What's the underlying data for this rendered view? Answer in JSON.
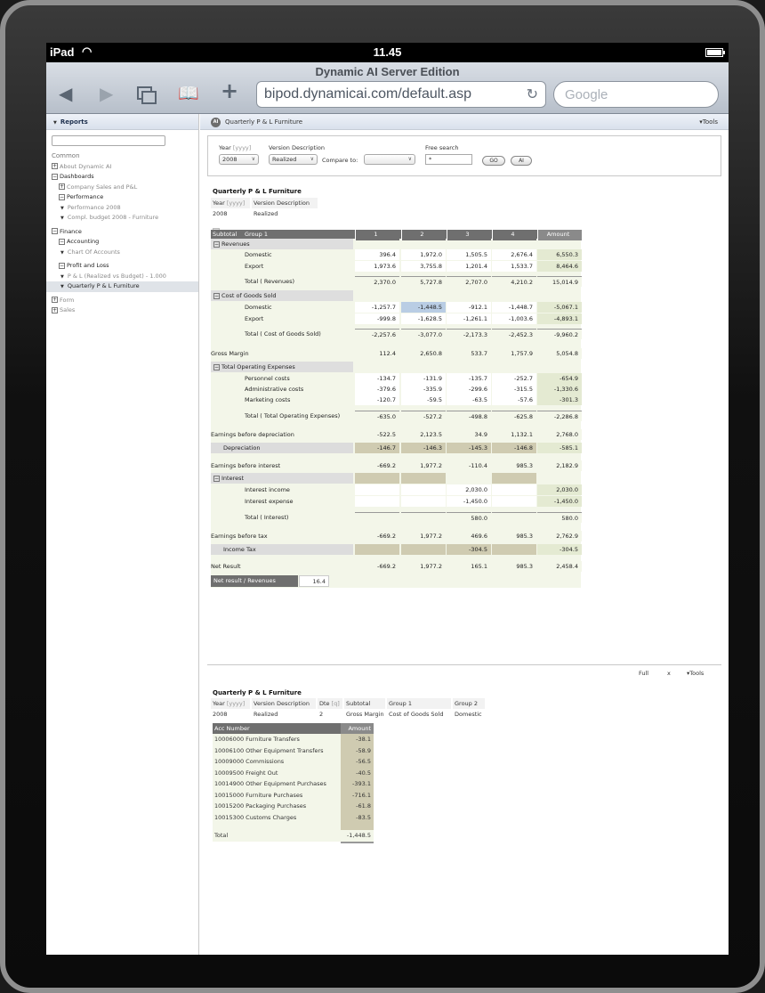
{
  "device": {
    "carrier": "iPad",
    "time": "11.45",
    "browser_title": "Dynamic AI Server Edition",
    "url": "bipod.dynamicai.com/default.asp",
    "search_placeholder": "Google"
  },
  "sidebar": {
    "title": "Reports",
    "section_common": "Common",
    "about": "About Dynamic AI",
    "dashboards": "Dashboards",
    "company_sales": "Company Sales and P&L",
    "performance": "Performance",
    "performance_2008": "Performance 2008",
    "compl_budget": "Compl. budget 2008 - Furniture",
    "finance": "Finance",
    "accounting": "Accounting",
    "chart_of_accounts": "Chart Of Accounts",
    "profit_and_loss": "Profit and Loss",
    "pl_realized_vs_budget": "P & L (Realized vs Budget) - 1.000",
    "quarterly_pl_furniture": "Quarterly P & L Furniture",
    "form": "Form",
    "sales": "Sales"
  },
  "main": {
    "header_title": "Quarterly P & L Furniture",
    "tools": "Tools",
    "filters": {
      "year_label": "Year",
      "year_hint": "[yyyy]",
      "year_value": "2008",
      "version_label": "Version Description",
      "version_value": "Realized",
      "compare_label": "Compare to:",
      "compare_value": "",
      "free_search_label": "Free search",
      "free_search_value": "*",
      "go_button": "GO",
      "ai_button": "AI"
    },
    "report": {
      "title": "Quarterly P & L Furniture",
      "meta_year_label": "Year",
      "meta_year_hint": "[yyyy]",
      "meta_version_label": "Version Description",
      "meta_year_value": "2008",
      "meta_version_value": "Realized",
      "minus_glyph": "−",
      "columns": [
        "Subtotal",
        "Group 1",
        "1",
        "2",
        "3",
        "4",
        "Amount"
      ],
      "revenues": "Revenues",
      "domestic": "Domestic",
      "export": "Export",
      "total_revenues": "Total ( Revenues)",
      "cogs": "Cost of Goods Sold",
      "total_cogs": "Total ( Cost of Goods Sold)",
      "gross_margin": "Gross Margin",
      "total_opex": "Total Operating Expenses",
      "personnel": "Personnel costs",
      "admin": "Administrative costs",
      "marketing": "Marketing costs",
      "total_total_opex": "Total ( Total Operating Expenses)",
      "ebd": "Earnings before depreciation",
      "depreciation": "Depreciation",
      "ebi": "Earnings before interest",
      "interest": "Interest",
      "interest_income": "Interest income",
      "interest_expense": "Interest expense",
      "total_interest": "Total ( Interest)",
      "ebt": "Earnings before tax",
      "income_tax": "Income Tax",
      "net_result": "Net Result",
      "net_result_revenues": "Net result / Revenues",
      "net_result_revenues_value": "16.4",
      "values": {
        "rev_dom": [
          "396.4",
          "1,972.0",
          "1,505.5",
          "2,676.4",
          "6,550.3"
        ],
        "rev_exp": [
          "1,973.6",
          "3,755.8",
          "1,201.4",
          "1,533.7",
          "8,464.6"
        ],
        "rev_tot": [
          "2,370.0",
          "5,727.8",
          "2,707.0",
          "4,210.2",
          "15,014.9"
        ],
        "cogs_dom": [
          "-1,257.7",
          "-1,448.5",
          "-912.1",
          "-1,448.7",
          "-5,067.1"
        ],
        "cogs_exp": [
          "-999.8",
          "-1,628.5",
          "-1,261.1",
          "-1,003.6",
          "-4,893.1"
        ],
        "cogs_tot": [
          "-2,257.6",
          "-3,077.0",
          "-2,173.3",
          "-2,452.3",
          "-9,960.2"
        ],
        "gross": [
          "112.4",
          "2,650.8",
          "533.7",
          "1,757.9",
          "5,054.8"
        ],
        "pers": [
          "-134.7",
          "-131.9",
          "-135.7",
          "-252.7",
          "-654.9"
        ],
        "admin": [
          "-379.6",
          "-335.9",
          "-299.6",
          "-315.5",
          "-1,330.6"
        ],
        "mkt": [
          "-120.7",
          "-59.5",
          "-63.5",
          "-57.6",
          "-301.3"
        ],
        "opex_tot": [
          "-635.0",
          "-527.2",
          "-498.8",
          "-625.8",
          "-2,286.8"
        ],
        "ebd": [
          "-522.5",
          "2,123.5",
          "34.9",
          "1,132.1",
          "2,768.0"
        ],
        "dep": [
          "-146.7",
          "-146.3",
          "-145.3",
          "-146.8",
          "-585.1"
        ],
        "ebi": [
          "-669.2",
          "1,977.2",
          "-110.4",
          "985.3",
          "2,182.9"
        ],
        "int_inc": [
          "",
          "",
          "2,030.0",
          "",
          "2,030.0"
        ],
        "int_exp": [
          "",
          "",
          "-1,450.0",
          "",
          "-1,450.0"
        ],
        "int_tot": [
          "",
          "",
          "580.0",
          "",
          "580.0"
        ],
        "ebt": [
          "-669.2",
          "1,977.2",
          "469.6",
          "985.3",
          "2,762.9"
        ],
        "tax": [
          "",
          "",
          "-304.5",
          "",
          "-304.5"
        ],
        "net": [
          "-669.2",
          "1,977.2",
          "165.1",
          "985.3",
          "2,458.4"
        ]
      }
    },
    "bottom": {
      "full": "Full",
      "close": "x",
      "tools": "Tools",
      "title": "Quarterly P & L Furniture",
      "meta_headers": [
        "Year",
        "Version Description",
        "Dte",
        "Subtotal",
        "Group 1",
        "Group 2"
      ],
      "meta_hints": [
        "[yyyy]",
        "",
        "[q]",
        "",
        "",
        ""
      ],
      "meta_values": [
        "2008",
        "Realized",
        "2",
        "Gross Margin",
        "Cost of Goods Sold",
        "Domestic"
      ],
      "col_acc": "Acc Number",
      "col_amount": "Amount",
      "rows": [
        {
          "acc": "10006000 Furniture Transfers",
          "amount": "-38.1"
        },
        {
          "acc": "10006100 Other Equipment Transfers",
          "amount": "-58.9"
        },
        {
          "acc": "10009000 Commissions",
          "amount": "-56.5"
        },
        {
          "acc": "10009500 Freight Out",
          "amount": "-40.5"
        },
        {
          "acc": "10014900 Other Equipment Purchases",
          "amount": "-393.1"
        },
        {
          "acc": "10015000 Furniture Purchases",
          "amount": "-716.1"
        },
        {
          "acc": "10015200 Packaging Purchases",
          "amount": "-61.8"
        },
        {
          "acc": "10015300 Customs Charges",
          "amount": "-83.5"
        }
      ],
      "total_label": "Total",
      "total_value": "-1,448.5"
    }
  }
}
